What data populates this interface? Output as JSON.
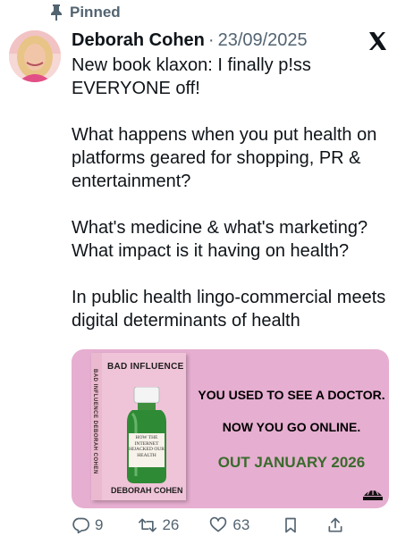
{
  "pinned_label": "Pinned",
  "author": {
    "name": "Deborah Cohen",
    "separator": "·",
    "date": "23/09/2025"
  },
  "tweet": {
    "paragraphs": [
      "New book klaxon: I finally p!ss EVERYONE off!",
      "What happens when you put health on platforms geared for shopping, PR & entertainment?",
      "What's medicine & what's marketing? What impact is it having on health?",
      "In public health lingo-commercial meets digital determinants of health"
    ]
  },
  "media": {
    "cover_title": "BAD INFLUENCE",
    "spine_text": "BAD INFLUENCE  DEBORAH COHEN",
    "cover_author": "DEBORAH COHEN",
    "bottle_label": "HOW THE INTERNET HIJACKED OUR HEALTH",
    "promo_line_1": "YOU USED TO SEE A DOCTOR.",
    "promo_line_2": "NOW YOU GO ONLINE.",
    "promo_line_3": "OUT JANUARY 2026",
    "publisher_logo_text": "ONEWORLD"
  },
  "actions": {
    "replies": "9",
    "reposts": "26",
    "likes": "63"
  },
  "colors": {
    "secondary_text": "#536471",
    "media_background": "#e6aed0",
    "promo_green": "#386b2c"
  },
  "icons": [
    "pin-icon",
    "x-logo-icon",
    "reply-icon",
    "repost-icon",
    "like-icon",
    "bookmark-icon",
    "share-icon"
  ]
}
